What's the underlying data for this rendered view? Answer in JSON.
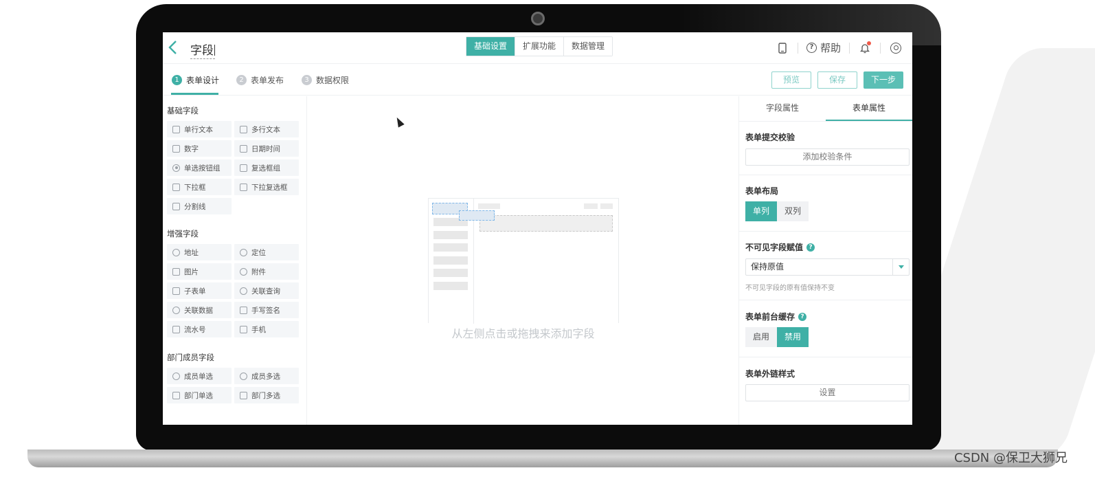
{
  "header": {
    "title": "字段",
    "tabs": [
      {
        "label": "基础设置",
        "active": true
      },
      {
        "label": "扩展功能",
        "active": false
      },
      {
        "label": "数据管理",
        "active": false
      }
    ],
    "help_label": "帮助",
    "icons": [
      "back-icon",
      "mobile-preview-icon",
      "help-icon",
      "bell-icon",
      "user-icon"
    ]
  },
  "steps": [
    {
      "num": "1",
      "label": "表单设计",
      "active": true
    },
    {
      "num": "2",
      "label": "表单发布",
      "active": false
    },
    {
      "num": "3",
      "label": "数据权限",
      "active": false
    }
  ],
  "actions": {
    "preview": "预览",
    "save": "保存",
    "next": "下一步"
  },
  "left_panel": {
    "sections": [
      {
        "title": "基础字段",
        "items": [
          "单行文本",
          "多行文本",
          "数字",
          "日期时间",
          "单选按钮组",
          "复选框组",
          "下拉框",
          "下拉复选框",
          "分割线"
        ]
      },
      {
        "title": "增强字段",
        "items": [
          "地址",
          "定位",
          "图片",
          "附件",
          "子表单",
          "关联查询",
          "关联数据",
          "手写签名",
          "流水号",
          "手机"
        ]
      },
      {
        "title": "部门成员字段",
        "items": [
          "成员单选",
          "成员多选",
          "部门单选",
          "部门多选"
        ]
      }
    ]
  },
  "canvas": {
    "hint": "从左侧点击或拖拽来添加字段"
  },
  "right_panel": {
    "tabs": [
      {
        "label": "字段属性",
        "active": false
      },
      {
        "label": "表单属性",
        "active": true
      }
    ],
    "submit_check": {
      "label": "表单提交校验",
      "button": "添加校验条件"
    },
    "layout": {
      "label": "表单布局",
      "options": [
        "单列",
        "双列"
      ],
      "selected": "单列"
    },
    "invisible_value": {
      "label": "不可见字段赋值",
      "select_value": "保持原值",
      "note": "不可见字段的原有值保持不变"
    },
    "cache": {
      "label": "表单前台缓存",
      "options": [
        "启用",
        "禁用"
      ],
      "selected": "禁用"
    },
    "external_link": {
      "label": "表单外链样式",
      "button": "设置"
    }
  },
  "watermark": "CSDN @保卫大狮兄",
  "colors": {
    "accent": "#3fb0a6",
    "laptop_frame": "#0c0c0c"
  }
}
